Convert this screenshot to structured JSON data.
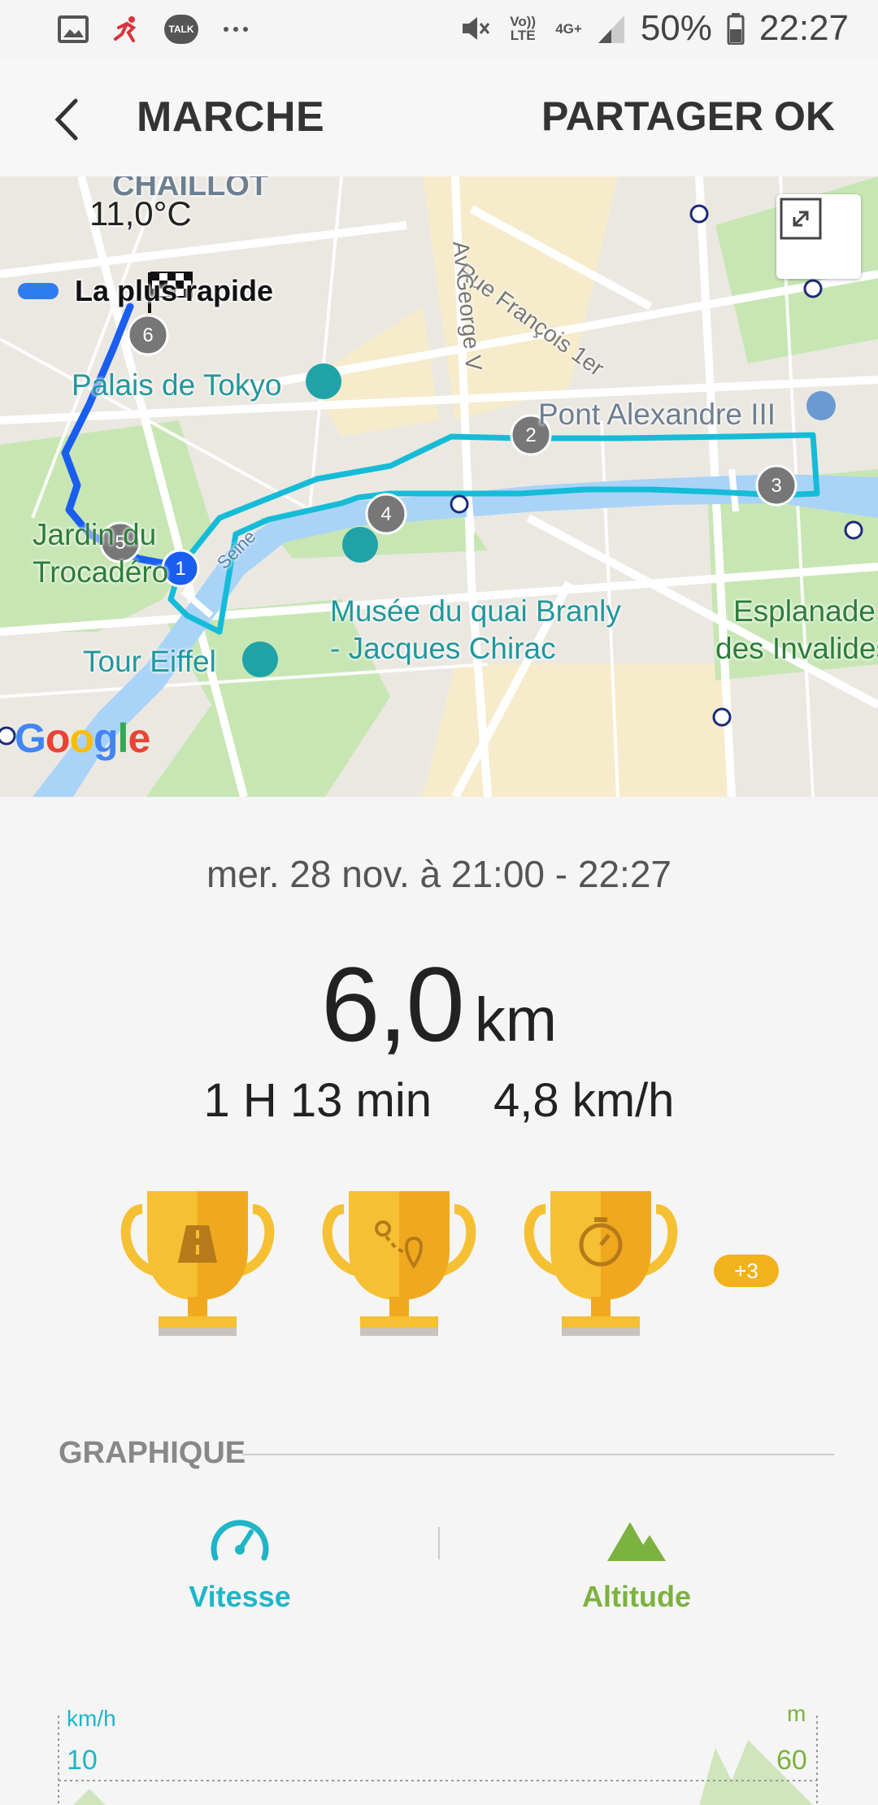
{
  "status_bar": {
    "volte": "Vo)) LTE",
    "network": "4G+",
    "battery": "50%",
    "time": "22:27",
    "left_icons": [
      "image-icon",
      "running-icon",
      "talk-icon",
      "more-dots-icon"
    ],
    "talk_label": "TALK"
  },
  "app_bar": {
    "title": "MARCHE",
    "share_label": "PARTAGER",
    "ok_label": "OK"
  },
  "map": {
    "temperature": "11,0°C",
    "legend_label": "La plus rapide",
    "labels": {
      "chaillot": "CHAILLOT",
      "palais": "Palais de Tokyo",
      "pont": "Pont Alexandre III",
      "jardin1": "Jardin du",
      "jardin2": "Trocadéro",
      "musee1": "Musée du quai Branly",
      "musee2": "- Jacques Chirac",
      "tour": "Tour Eiffel",
      "esplanade1": "Esplanade",
      "esplanade2": "des Invalides",
      "rue_francois": "Rue François 1er",
      "av_george": "Av George V",
      "seine": "Seine"
    },
    "markers": [
      "1",
      "2",
      "3",
      "4",
      "5",
      "6"
    ],
    "route_color": "#1ec6e6",
    "start_color": "#1a5ef0"
  },
  "workout": {
    "date": "mer. 28 nov. à 21:00 - 22:27",
    "distance_value": "6,0",
    "distance_unit": "km",
    "duration": "1 H 13 min",
    "speed": "4,8 km/h",
    "more_badge": "+3"
  },
  "graph": {
    "section_title": "GRAPHIQUE",
    "tabs": [
      {
        "label": "Vitesse",
        "color": "#1fb5c9"
      },
      {
        "label": "Altitude",
        "color": "#7cb23f"
      }
    ],
    "left_unit": "km/h",
    "left_value": "10",
    "right_unit": "m",
    "right_value": "60"
  },
  "colors": {
    "trophy": "#f5c033",
    "vitesse": "#1fb5c9",
    "altitude": "#7cb23f"
  }
}
